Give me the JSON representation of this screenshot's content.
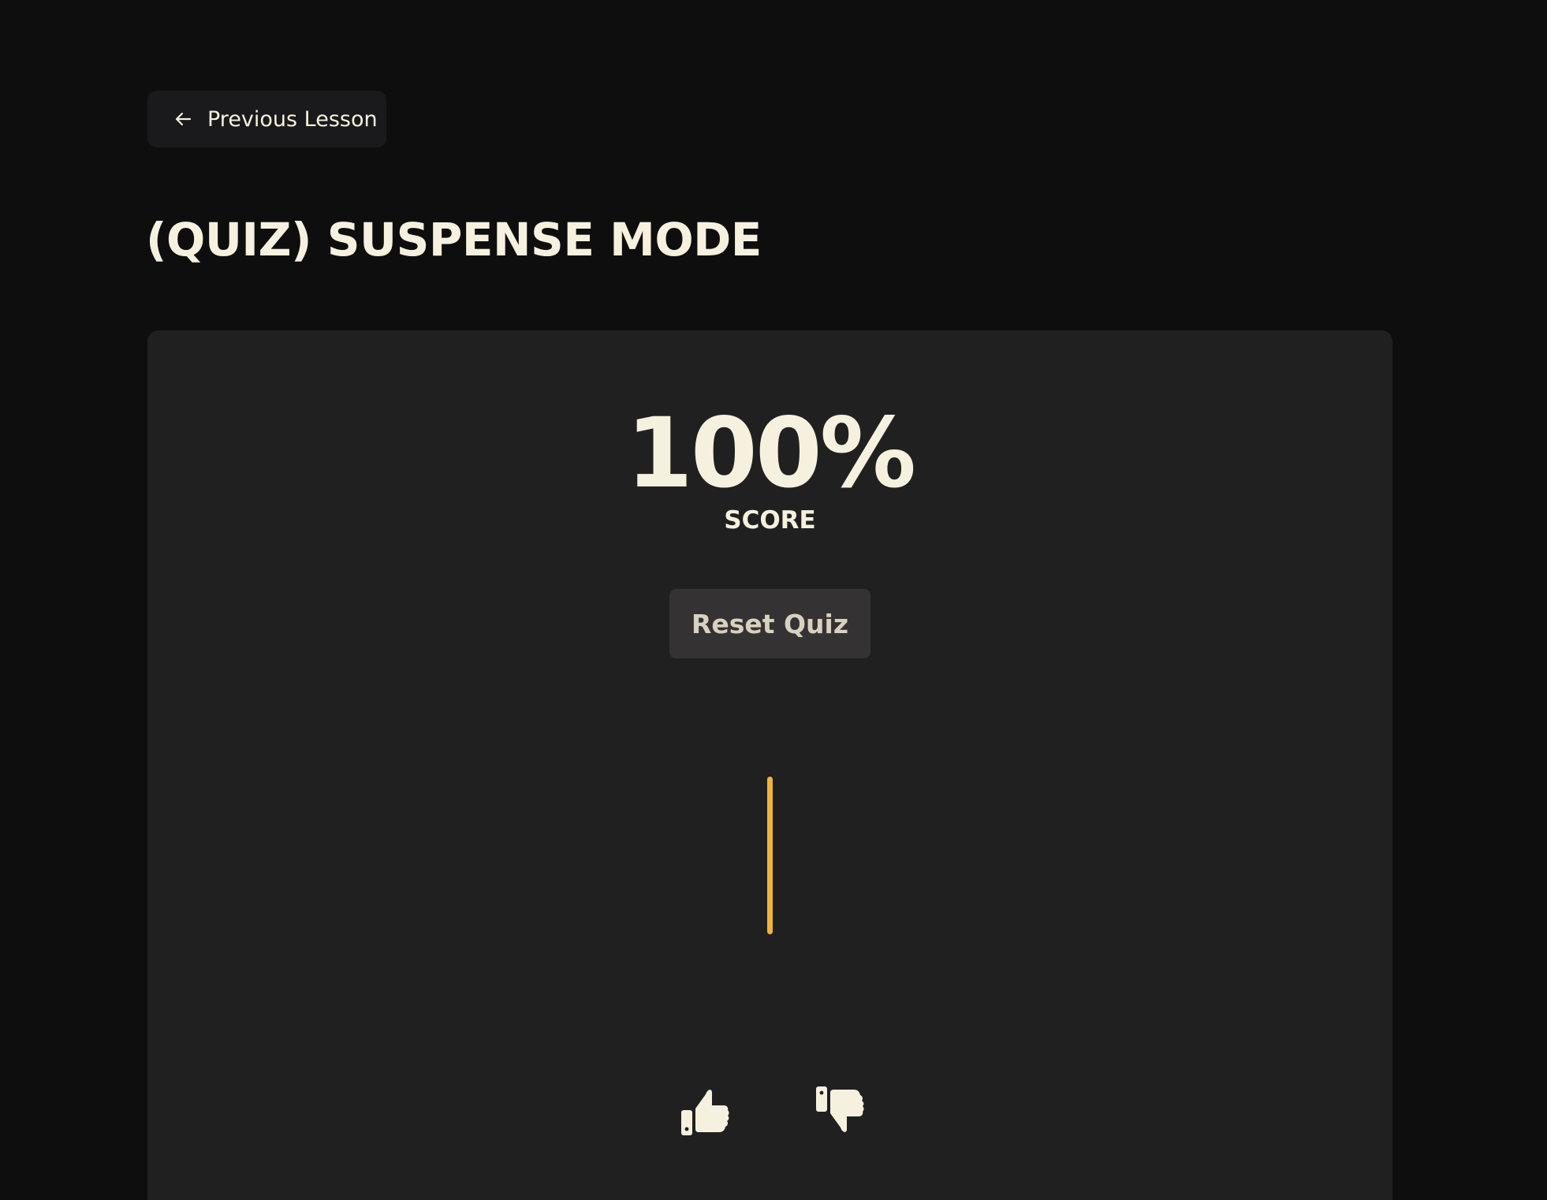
{
  "nav": {
    "previous_label": "Previous Lesson",
    "previous_icon": "arrow-left-icon"
  },
  "page": {
    "title": "(QUIZ) SUSPENSE MODE"
  },
  "result": {
    "score_value": "100%",
    "score_label": "SCORE",
    "reset_label": "Reset Quiz"
  },
  "feedback": {
    "like_icon": "thumbs-up-icon",
    "dislike_icon": "thumbs-down-icon"
  },
  "colors": {
    "background": "#0f0e0f",
    "card": "#212021",
    "text": "#f6f1de",
    "accent": "#f2b33d",
    "button": "#353233"
  }
}
